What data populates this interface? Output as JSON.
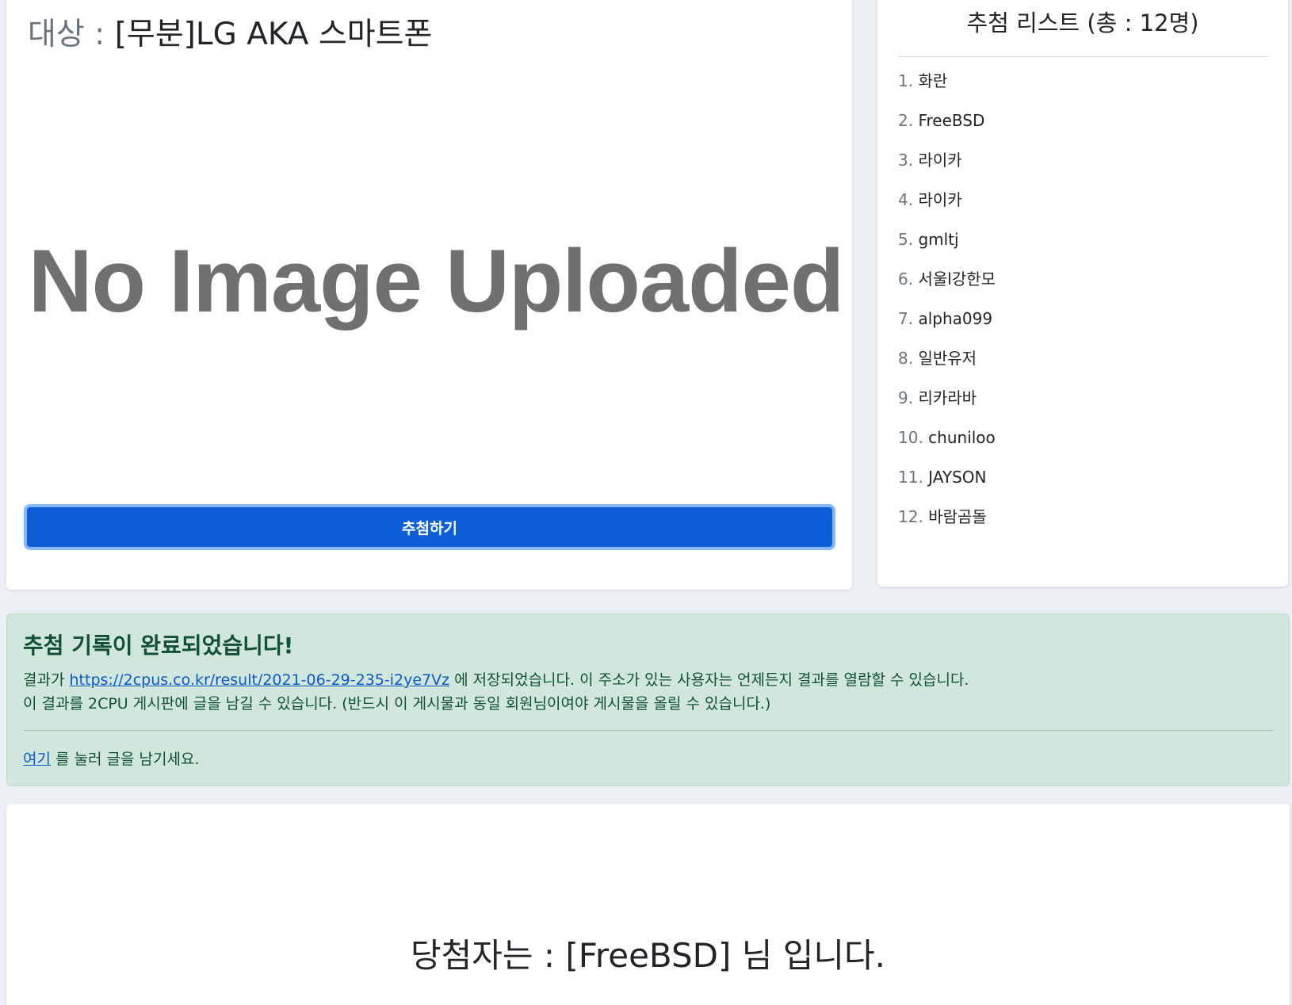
{
  "target": {
    "label": "대상 :",
    "name": "[무분]LG AKA 스마트폰"
  },
  "image_placeholder": "No Image Uploaded",
  "draw_button_label": "추첨하기",
  "draw_list": {
    "title": "추첨 리스트 (총 : 12명)",
    "items": [
      {
        "num": "1.",
        "name": "화란"
      },
      {
        "num": "2.",
        "name": "FreeBSD"
      },
      {
        "num": "3.",
        "name": "라이카"
      },
      {
        "num": "4.",
        "name": "라이카"
      },
      {
        "num": "5.",
        "name": "gmltj"
      },
      {
        "num": "6.",
        "name": "서울l강한모"
      },
      {
        "num": "7.",
        "name": "alpha099"
      },
      {
        "num": "8.",
        "name": "일반유저"
      },
      {
        "num": "9.",
        "name": "리카라바"
      },
      {
        "num": "10.",
        "name": "chuniloo"
      },
      {
        "num": "11.",
        "name": "JAYSON"
      },
      {
        "num": "12.",
        "name": "바람곰돌"
      }
    ]
  },
  "alert": {
    "heading": "추첨 기록이 완료되었습니다!",
    "line1_prefix": "결과가",
    "result_url": "https://2cpus.co.kr/result/2021-06-29-235-i2ye7Vz",
    "line1_suffix": "에 저장되었습니다. 이 주소가 있는 사용자는 언제든지 결과를 열람할 수 있습니다.",
    "line2": "이 결과를 2CPU 게시판에 글을 남길 수 있습니다. (반드시 이 게시물과 동일 회원님이여야 게시물을 올릴 수 있습니다.)",
    "here_link": "여기",
    "line3_suffix": "를 눌러 글을 남기세요."
  },
  "winner": {
    "text": "당첨자는 : [FreeBSD] 님 입니다."
  },
  "colors": {
    "primary_button": "#0d5fd9",
    "alert_bg": "#d1e7dd",
    "alert_text": "#0f5132",
    "link": "#0a58ca"
  }
}
